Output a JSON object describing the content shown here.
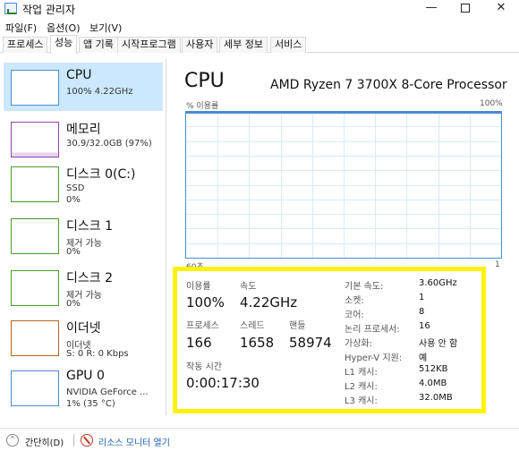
{
  "window": {
    "title": "작업 관리자",
    "minimize": "—",
    "close": "✕"
  },
  "menu": [
    "파일(F)",
    "옵션(O)",
    "보기(V)"
  ],
  "tabs": [
    "프로세스",
    "성능",
    "앱 기록",
    "시작프로그램",
    "사용자",
    "세부 정보",
    "서비스"
  ],
  "sidebar": [
    {
      "name": "CPU",
      "sub1": "100% 4.22GHz",
      "sub2": "",
      "color": "#4a8ccf"
    },
    {
      "name": "메모리",
      "sub1": "30.9/32.0GB (97%)",
      "sub2": "",
      "color": "#8e44ad"
    },
    {
      "name": "디스크 0(C:)",
      "sub1": "SSD",
      "sub2": "0%",
      "color": "#4d9b2d"
    },
    {
      "name": "디스크 1",
      "sub1": "제거 가능",
      "sub2": "0%",
      "color": "#4d9b2d"
    },
    {
      "name": "디스크 2",
      "sub1": "제거 가능",
      "sub2": "0%",
      "color": "#4d9b2d"
    },
    {
      "name": "이더넷",
      "sub1": "이더넷",
      "sub2": "S: 0 R: 0 Kbps",
      "color": "#b5651d"
    },
    {
      "name": "GPU 0",
      "sub1": "NVIDIA GeForce ...",
      "sub2": "1% (35 °C)",
      "color": "#4a8ccf"
    }
  ],
  "main": {
    "title": "CPU",
    "processor": "AMD Ryzen 7 3700X 8-Core Processor",
    "graph_label": "% 이용률",
    "graph_max": "100%",
    "axis_left": "60초",
    "axis_right": "1",
    "utilization": 100
  },
  "stats": {
    "util_label": "이용률",
    "util": "100%",
    "speed_label": "속도",
    "speed": "4.22GHz",
    "proc_label": "프로세스",
    "proc": "166",
    "thread_label": "스레드",
    "thread": "1658",
    "handle_label": "핸들",
    "handle": "58974",
    "uptime_label": "작동 시간",
    "uptime": "0:00:17:30"
  },
  "details": [
    {
      "k": "기본 속도:",
      "v": "3.60GHz"
    },
    {
      "k": "소켓:",
      "v": "1"
    },
    {
      "k": "코어:",
      "v": "8"
    },
    {
      "k": "논리 프로세서:",
      "v": "16"
    },
    {
      "k": "가상화:",
      "v": "사용 안 함"
    },
    {
      "k": "Hyper-V 지원:",
      "v": "예"
    },
    {
      "k": "L1 캐시:",
      "v": "512KB"
    },
    {
      "k": "L2 캐시:",
      "v": "4.0MB"
    },
    {
      "k": "L3 캐시:",
      "v": "32.0MB"
    }
  ],
  "footer": {
    "simple": "간단히(D)",
    "monitor": "리소스 모니터 열기"
  },
  "colors": {
    "highlight": "#fff20a",
    "selected": "#cce8ff",
    "graph_border": "#4a8ccf"
  }
}
